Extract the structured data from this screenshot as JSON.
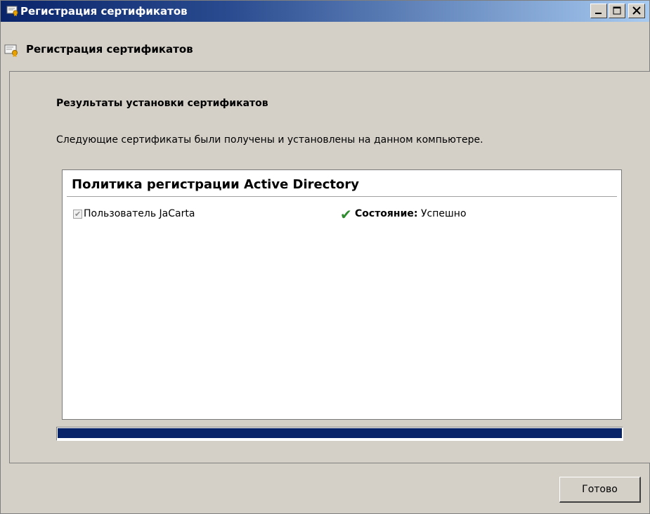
{
  "window": {
    "title": "Регистрация сертификатов",
    "app_icon": "certificate-icon",
    "buttons": {
      "minimize": "minimize-icon",
      "maximize": "maximize-icon",
      "close": "close-icon"
    }
  },
  "header": {
    "icon": "certificate-icon",
    "title": "Регистрация сертификатов"
  },
  "main": {
    "section_title": "Результаты установки сертификатов",
    "description": "Следующие сертификаты были получены и установлены на данном компьютере.",
    "policy": {
      "title": "Политика регистрации Active Directory",
      "items": [
        {
          "label": "Пользователь JaCarta",
          "checked": true,
          "status_icon": "checkmark-icon",
          "status_label": "Состояние:",
          "status_value": "Успешно"
        }
      ]
    },
    "progress": {
      "value": 1.0
    }
  },
  "footer": {
    "done_label": "Готово"
  },
  "colors": {
    "titlebar_start": "#0a246a",
    "titlebar_end": "#a6caf0",
    "progress_fill": "#0a246a",
    "success_check": "#2e8b2e",
    "dialog_bg": "#d4d0c8"
  }
}
